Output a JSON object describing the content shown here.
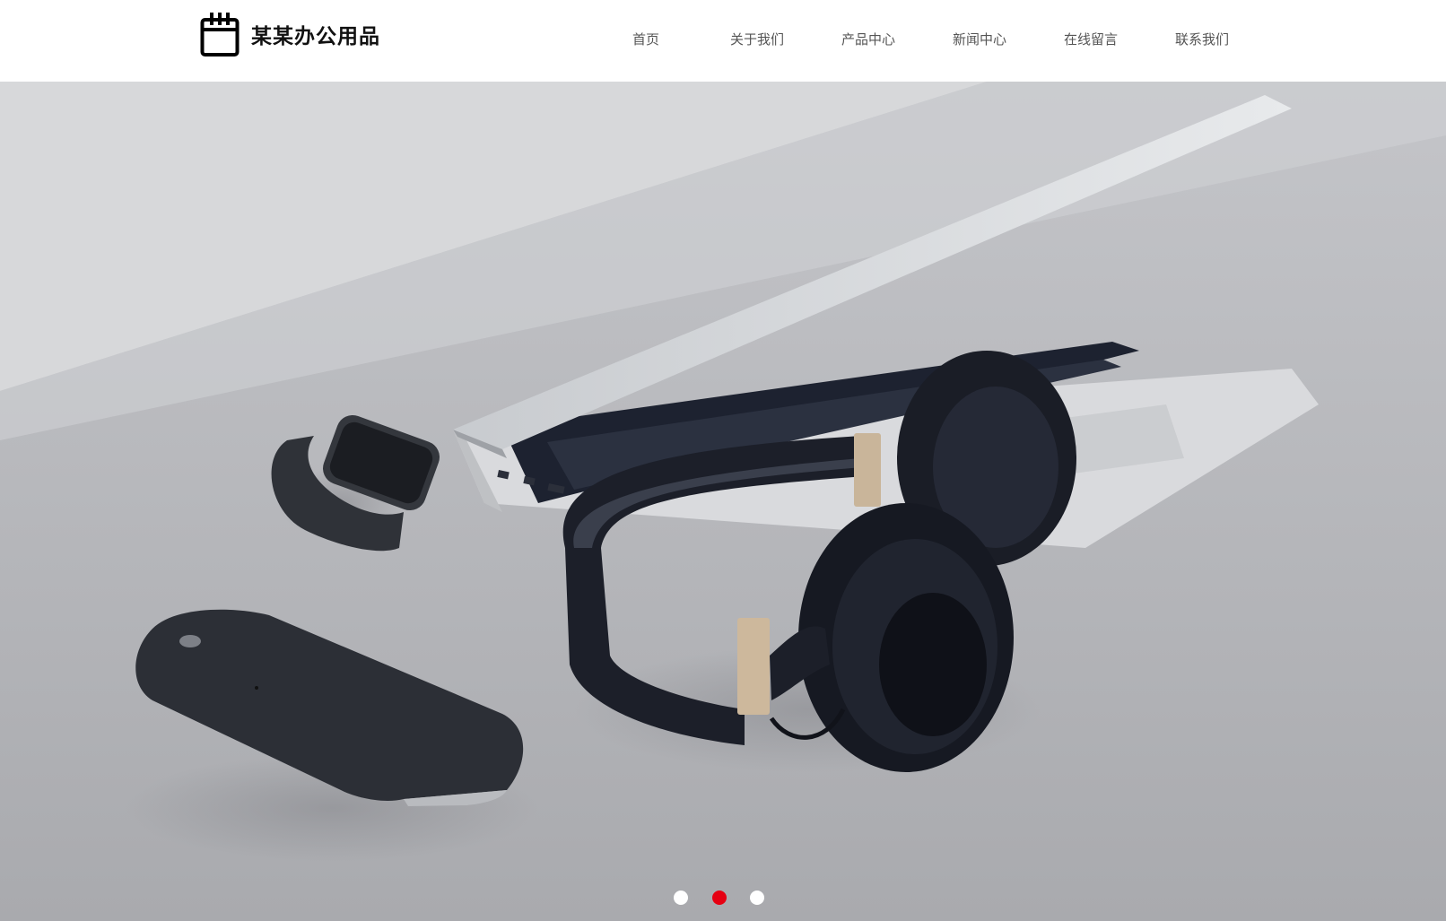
{
  "header": {
    "brand": "某某办公用品",
    "logo_icon": "calendar-icon"
  },
  "nav": {
    "items": [
      {
        "label": "首页"
      },
      {
        "label": "关于我们"
      },
      {
        "label": "产品中心"
      },
      {
        "label": "新闻中心"
      },
      {
        "label": "在线留言"
      },
      {
        "label": "联系我们"
      }
    ]
  },
  "hero": {
    "slide_count": 3,
    "active_slide": 2,
    "active_dot_color": "#e60012",
    "inactive_dot_color": "#ffffff"
  },
  "colors": {
    "header_bg": "#ffffff",
    "nav_text": "#555555",
    "brand_text": "#111111"
  }
}
